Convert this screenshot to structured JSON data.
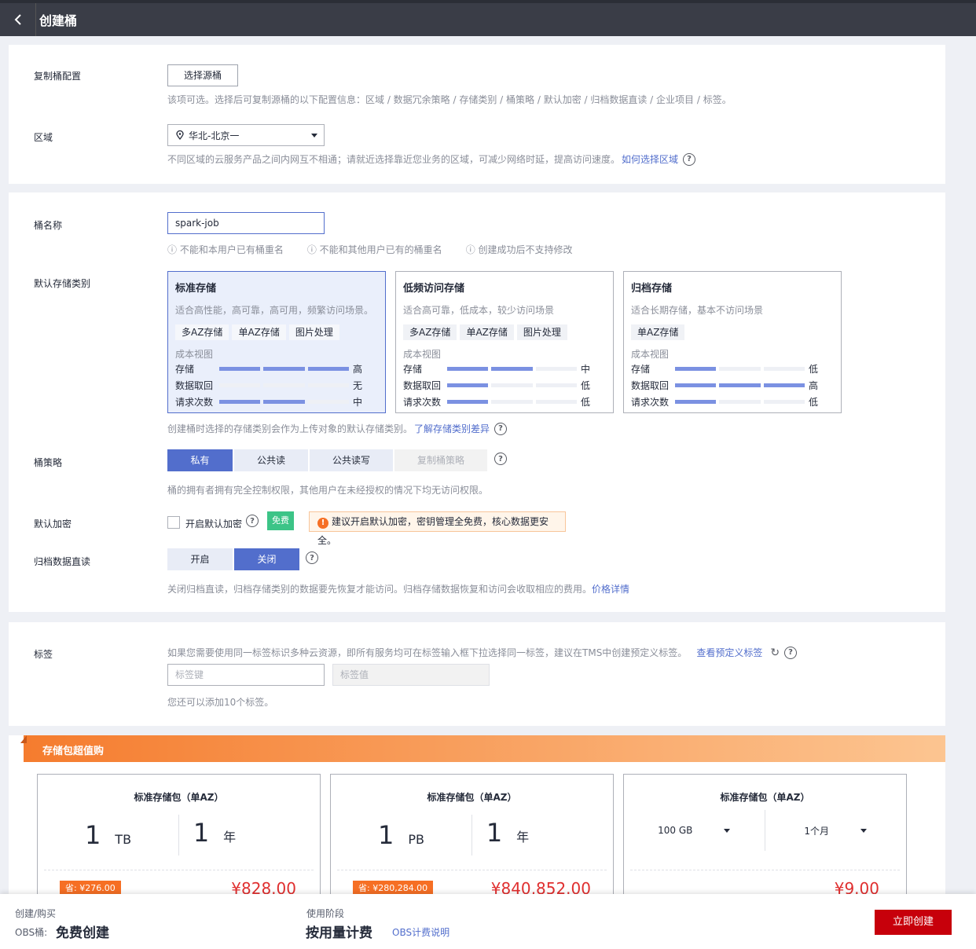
{
  "header": {
    "title": "创建桶"
  },
  "replicate": {
    "label": "复制桶配置",
    "button": "选择源桶",
    "hint": "该项可选。选择后可复制源桶的以下配置信息：区域 / 数据冗余策略 / 存储类别 / 桶策略 / 默认加密 / 归档数据直读 / 企业项目 / 标签。"
  },
  "region": {
    "label": "区域",
    "value": "华北-北京一",
    "hint": "不同区域的云服务产品之间内网互不相通；请就近选择靠近您业务的区域，可减少网络时延，提高访问速度。",
    "link": "如何选择区域"
  },
  "bucket_name": {
    "label": "桶名称",
    "value": "spark-job",
    "rules": [
      "不能和本用户已有桶重名",
      "不能和其他用户已有的桶重名",
      "创建成功后不支持修改"
    ]
  },
  "storage": {
    "label": "默认存储类别",
    "cost_view": "成本视图",
    "row_labels": [
      "存储",
      "数据取回",
      "请求次数"
    ],
    "classes": [
      {
        "title": "标准存储",
        "desc": "适合高性能，高可靠，高可用，频繁访问场景。",
        "tags": [
          "多AZ存储",
          "单AZ存储",
          "图片处理"
        ],
        "levels": [
          3,
          0,
          2
        ],
        "values": [
          "高",
          "无",
          "中"
        ]
      },
      {
        "title": "低频访问存储",
        "desc": "适合高可靠，低成本，较少访问场景",
        "tags": [
          "多AZ存储",
          "单AZ存储",
          "图片处理"
        ],
        "levels": [
          2,
          1,
          1
        ],
        "values": [
          "中",
          "低",
          "低"
        ]
      },
      {
        "title": "归档存储",
        "desc": "适合长期存储，基本不访问场景",
        "tags": [
          "单AZ存储"
        ],
        "levels": [
          1,
          3,
          1
        ],
        "values": [
          "低",
          "高",
          "低"
        ]
      }
    ],
    "hint": "创建桶时选择的存储类别会作为上传对象的默认存储类别。",
    "link": "了解存储类别差异"
  },
  "policy": {
    "label": "桶策略",
    "options": [
      "私有",
      "公共读",
      "公共读写",
      "复制桶策略"
    ],
    "hint": "桶的拥有者拥有完全控制权限，其他用户在未经授权的情况下均无访问权限。"
  },
  "encryption": {
    "label": "默认加密",
    "checkbox": "开启默认加密",
    "badge": "免费",
    "warning": "建议开启默认加密，密钥管理全免费，核心数据更安全。"
  },
  "archive": {
    "label": "归档数据直读",
    "on": "开启",
    "off": "关闭",
    "hint": "关闭归档直读，归档存储类别的数据要先恢复才能访问。归档存储数据恢复和访问会收取相应的费用。",
    "link": "价格详情"
  },
  "tags": {
    "label": "标签",
    "hint": "如果您需要使用同一标签标识多种云资源，即所有服务均可在标签输入框下拉选择同一标签，建议在TMS中创建预定义标签。",
    "link": "查看预定义标签",
    "key_placeholder": "标签键",
    "value_placeholder": "标签值",
    "remaining": "您还可以添加10个标签。"
  },
  "packages": {
    "banner": "存储包超值购",
    "items": [
      {
        "title": "标准存储包（单AZ）",
        "size": "1",
        "size_unit": "TB",
        "dur": "1",
        "dur_unit": "年",
        "save": "省: ¥276.00",
        "price": "¥828.00"
      },
      {
        "title": "标准存储包（单AZ）",
        "size": "1",
        "size_unit": "PB",
        "dur": "1",
        "dur_unit": "年",
        "save": "省: ¥280,284.00",
        "price": "¥840,852.00"
      },
      {
        "title": "标准存储包（单AZ）",
        "size_select": "100 GB",
        "dur_select": "1个月",
        "price": "¥9.00"
      }
    ]
  },
  "footer": {
    "create_label": "创建/购买",
    "obs_label": "OBS桶:",
    "free_create": "免费创建",
    "phase_label": "使用阶段",
    "pay": "按用量计费",
    "link": "OBS计费说明",
    "button": "立即创建"
  },
  "colors": {
    "primary": "#526ecc",
    "danger": "#c7000b",
    "banner": "#f8a760"
  }
}
